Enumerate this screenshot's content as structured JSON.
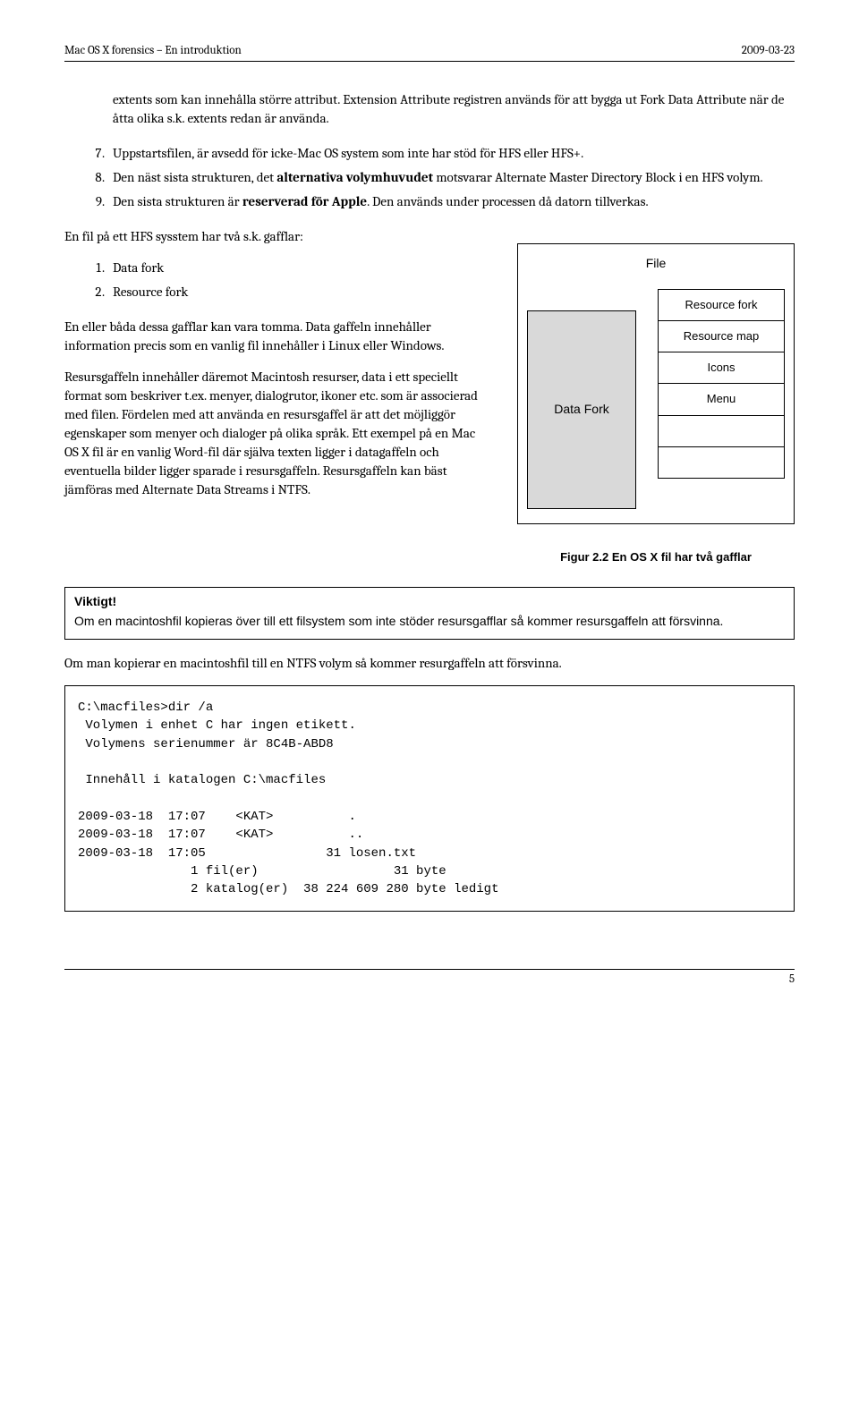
{
  "header": {
    "left": "Mac OS X forensics – En introduktion",
    "right": "2009-03-23"
  },
  "numlist": {
    "start": 7,
    "pre": "extents som kan innehålla större attribut. Extension Attribute registren används för att bygga ut Fork Data Attribute när de åtta olika s.k. extents redan är använda.",
    "i7": "Uppstartsfilen, är avsedd för icke-Mac OS system som inte har stöd för HFS eller HFS+.",
    "i8a": "Den näst sista strukturen, det ",
    "i8b": "alternativa volymhuvudet",
    "i8c": " motsvarar Alternate Master Directory Block i en HFS volym.",
    "i9a": "Den sista strukturen är ",
    "i9b": "reserverad för Apple",
    "i9c": ". Den används under processen då datorn tillverkas."
  },
  "gafflar_intro": "En fil på ett HFS sysstem har två s.k. gafflar:",
  "gafflar_list": {
    "a": "Data fork",
    "b": "Resource fork"
  },
  "leftcol": {
    "p1": "En eller båda dessa gafflar kan vara tomma. Data gaffeln innehåller information precis som en vanlig fil innehåller i Linux eller Windows.",
    "p2": "Resursgaffeln innehåller däremot Macintosh resurser, data i ett speciellt format som beskriver t.ex. menyer, dialogrutor, ikoner etc. som är associerad med filen. Fördelen med att använda en resursgaffel är att det möjliggör egenskaper som menyer och dialoger på olika språk. Ett exempel på en Mac OS X fil är en vanlig Word-fil där själva texten ligger i datagaffeln och eventuella bilder ligger sparade i resursgaffeln. Resursgaffeln kan bäst jämföras med Alternate Data Streams i NTFS."
  },
  "diagram": {
    "file": "File",
    "datafork": "Data Fork",
    "res": {
      "rfork": "Resource fork",
      "rmap": "Resource map",
      "icons": "Icons",
      "menu": "Menu",
      "blank1": "",
      "blank2": ""
    },
    "caption": "Figur 2.2 En OS X fil har två gafflar"
  },
  "viktigt": {
    "heading": "Viktigt!",
    "body": "Om en macintoshfil kopieras över till ett filsystem som inte stöder resursgafflar så kommer resursgaffeln att försvinna."
  },
  "after_viktigt": "Om man kopierar en macintoshfil till en NTFS volym så kommer resurgaffeln att försvinna.",
  "dir_listing": "C:\\macfiles>dir /a\n Volymen i enhet C har ingen etikett.\n Volymens serienummer är 8C4B-ABD8\n\n Innehåll i katalogen C:\\macfiles\n\n2009-03-18  17:07    <KAT>          .\n2009-03-18  17:07    <KAT>          ..\n2009-03-18  17:05                31 losen.txt\n               1 fil(er)                  31 byte\n               2 katalog(er)  38 224 609 280 byte ledigt",
  "page_number": "5"
}
